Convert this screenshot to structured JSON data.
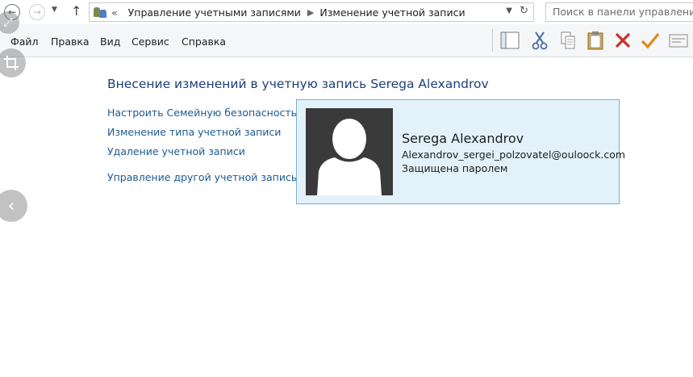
{
  "address_bar": {
    "overflow_chevron": "«",
    "breadcrumbs": [
      "Управление учетными записями",
      "Изменение учетной записи"
    ],
    "search_placeholder": "Поиск в панели управления"
  },
  "menu": {
    "items": [
      "Файл",
      "Правка",
      "Вид",
      "Сервис",
      "Справка"
    ]
  },
  "toolbar": {
    "icons": [
      "layout-pane-icon",
      "cut-icon",
      "copy-icon",
      "paste-icon",
      "delete-icon",
      "checkmark-icon",
      "properties-icon"
    ],
    "colors": {
      "delete": "#c8302a",
      "checkmark": "#e08a1e"
    }
  },
  "main": {
    "title": "Внесение изменений в учетную запись Serega Alexandrov",
    "tasks": [
      "Настроить Семейную безопасность",
      "Изменение типа учетной записи",
      "Удаление учетной записи",
      "Управление другой учетной записью"
    ],
    "account": {
      "name": "Serega Alexandrov",
      "email": "Alexandrov_sergei_polzovatel@ouloock.com",
      "status": "Защищена паролем"
    }
  },
  "colors": {
    "link": "#1c5a92",
    "title": "#1e3f7a",
    "card_background": "#e3f1fa",
    "card_border": "#7ab0d4"
  }
}
